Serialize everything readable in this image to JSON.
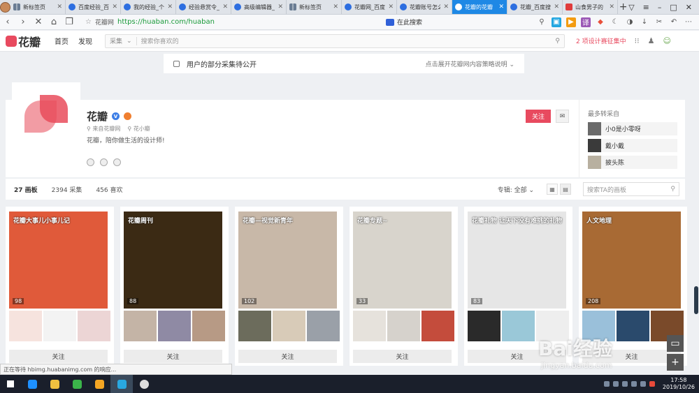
{
  "browser": {
    "tabs": [
      {
        "label": "新标签页",
        "fav": "grid"
      },
      {
        "label": "百度经验_百",
        "fav": "paw"
      },
      {
        "label": "我的经验_个",
        "fav": "paw"
      },
      {
        "label": "经验悬赏令_",
        "fav": "paw"
      },
      {
        "label": "高级编辑器_",
        "fav": "paw"
      },
      {
        "label": "新标签页",
        "fav": "grid"
      },
      {
        "label": "花瓣网_百度",
        "fav": "paw"
      },
      {
        "label": "花瓣账号怎么",
        "fav": "paw"
      },
      {
        "label": "花瓣的花瓣",
        "fav": "paw",
        "active": true
      },
      {
        "label": "花瓣_百度搜",
        "fav": "paw"
      },
      {
        "label": "山食男子的",
        "fav": "red"
      }
    ],
    "new_tab": "+",
    "address": {
      "site_label": "花瓣网",
      "url": "https://huaban.com/huaban",
      "search_engine_label": "在此搜索"
    }
  },
  "header": {
    "logo_text": "花瓣",
    "nav": [
      "首页",
      "发现"
    ],
    "search_scope": "采集",
    "search_placeholder": "搜索你喜欢的",
    "promo": "2 项设计赛征集中"
  },
  "notice": {
    "text": "用户的部分采集待公开",
    "expand": "点击展开花瓣网内容策略说明"
  },
  "profile": {
    "name": "花瓣",
    "from": "来自花瓣网",
    "location": "花小瓣",
    "bio": "花瓣，陪你做生活的设计师!",
    "follow_label": "关注",
    "msg_icon": "✉"
  },
  "repin": {
    "heading": "最多转采自",
    "users": [
      "小0是小零呀",
      "戴小戴",
      "披头陈"
    ]
  },
  "stats_bar": {
    "boards": "27 画板",
    "pins": "2394 采集",
    "likes": "456 喜欢",
    "filter": "专辑: 全部",
    "search_placeholder": "搜索TA的画板"
  },
  "boards": [
    {
      "title": "花瓣大事儿小事儿记",
      "count": "98",
      "follow": "关注",
      "cover": "#e05a3a",
      "thumbs": [
        "#f6e3de",
        "#f3f3f3",
        "#ecd5d5"
      ]
    },
    {
      "title": "花瓣周刊",
      "count": "88",
      "follow": "关注",
      "cover": "#3b2a14",
      "thumbs": [
        "#c4b4a6",
        "#8f8aa4",
        "#b79a85"
      ]
    },
    {
      "title": "花瓣—视觉新青年",
      "count": "102",
      "follow": "关注",
      "cover": "#c8b8a8",
      "thumbs": [
        "#6c6c5c",
        "#d8cbb8",
        "#9aa0a8"
      ]
    },
    {
      "title": "花瓣专题~",
      "count": "33",
      "follow": "关注",
      "cover": "#d8d4cc",
      "thumbs": [
        "#e6e2dc",
        "#d6d2cc",
        "#c44c3c"
      ]
    },
    {
      "title": "花瓣礼物 让天下没有难挑的礼物",
      "count": "83",
      "follow": "关注",
      "cover": "#e6e6e6",
      "thumbs": [
        "#2a2a2a",
        "#9ac8d8",
        "#eeeeee"
      ]
    },
    {
      "title": "人文地理",
      "count": "208",
      "follow": "关注",
      "cover": "#a86a34",
      "thumbs": [
        "#9ac0da",
        "#2a4a6c",
        "#7a4a2a"
      ]
    }
  ],
  "status_text": "正在等待 hbimg.huabanimg.com 的响应...",
  "watermark": {
    "main": "Bai经验",
    "sub": "jingyan.baidu.com"
  },
  "clock": {
    "time": "17:58",
    "date": "2019/10/26"
  }
}
